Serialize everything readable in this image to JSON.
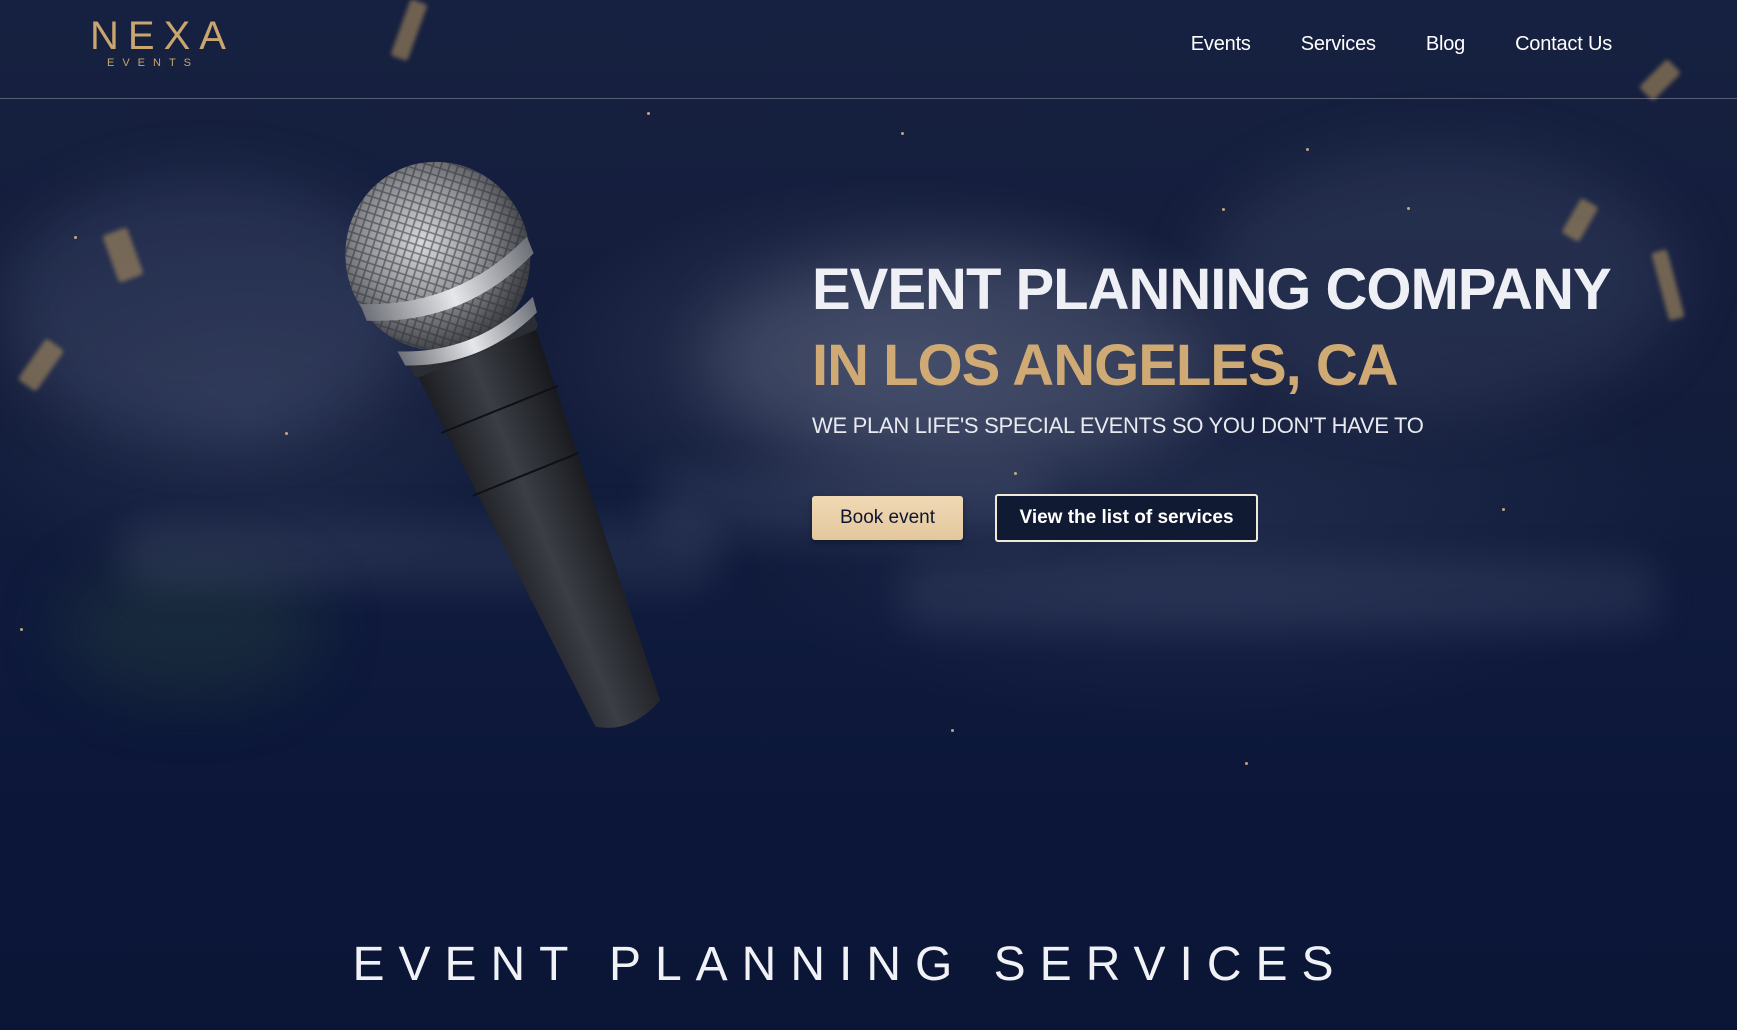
{
  "brand": {
    "logo_text": "NEXA",
    "logo_subtext": "EVENTS"
  },
  "nav": {
    "items": [
      "Events",
      "Services",
      "Blog",
      "Contact Us"
    ]
  },
  "hero": {
    "title_line1": "EVENT PLANNING COMPANY",
    "title_line2": "IN LOS ANGELES, CA",
    "subtitle": "WE PLAN LIFE'S SPECIAL EVENTS SO YOU DON'T HAVE TO",
    "primary_button": "Book event",
    "secondary_button": "View the list of services",
    "image": "microphone"
  },
  "sections": {
    "services_title": "EVENT PLANNING SERVICES"
  },
  "colors": {
    "background": "#0b1634",
    "accent_gold": "#cfaa74",
    "button_gold": "#e8cda3",
    "text_light": "#eef0f5"
  }
}
